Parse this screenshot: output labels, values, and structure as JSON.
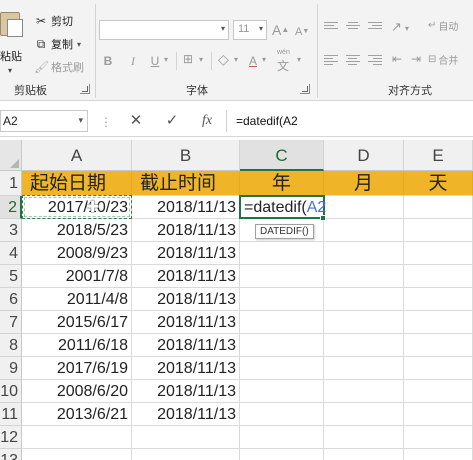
{
  "ribbon": {
    "clipboard": {
      "paste_label": "粘贴",
      "cut_label": "剪切",
      "copy_label": "复制",
      "format_painter_label": "格式刷",
      "group_label": "剪贴板"
    },
    "font": {
      "font_name": "",
      "font_size": "11",
      "group_label": "字体",
      "bold": "B",
      "italic": "I",
      "underline": "U",
      "grow": "A",
      "shrink": "A",
      "font_color_icon": "A",
      "wen_icon": "wén",
      "wen_glyph": "文"
    },
    "alignment": {
      "group_label": "对齐方式",
      "wrap_label": "自动",
      "merge_label": "合并"
    }
  },
  "formula_bar": {
    "name_box": "A2",
    "cancel_icon": "✕",
    "enter_icon": "✓",
    "fx_icon": "fx",
    "formula": "=datedif(A2"
  },
  "grid": {
    "columns": [
      "A",
      "B",
      "C",
      "D",
      "E"
    ],
    "active_column": "C",
    "rows": [
      "1",
      "2",
      "3",
      "4",
      "5",
      "6",
      "7",
      "8",
      "9",
      "10",
      "11",
      "12",
      "13"
    ],
    "active_row": "2",
    "header_row": [
      "起始日期",
      "截止时间",
      "年",
      "月",
      "天"
    ],
    "data": [
      [
        "2017/10/23",
        "2018/11/13"
      ],
      [
        "2018/5/23",
        "2018/11/13"
      ],
      [
        "2008/9/23",
        "2018/11/13"
      ],
      [
        "2001/7/8",
        "2018/11/13"
      ],
      [
        "2011/4/8",
        "2018/11/13"
      ],
      [
        "2015/6/17",
        "2018/11/13"
      ],
      [
        "2011/6/18",
        "2018/11/13"
      ],
      [
        "2017/6/19",
        "2018/11/13"
      ],
      [
        "2008/6/20",
        "2018/11/13"
      ],
      [
        "2013/6/21",
        "2018/11/13"
      ]
    ],
    "editing_cell": {
      "prefix": "=datedif(",
      "ref": "A2"
    },
    "function_tooltip": "DATEDIF()"
  },
  "colors": {
    "header_fill": "#f0b429",
    "accent_green": "#217346",
    "ref_blue": "#4a6fd0"
  }
}
